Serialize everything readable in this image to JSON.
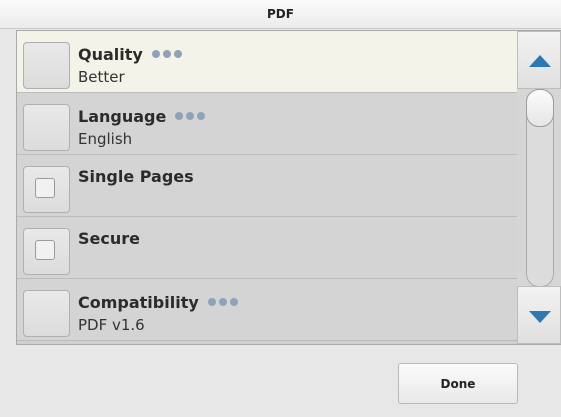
{
  "window": {
    "title": "PDF"
  },
  "settings": [
    {
      "title": "Quality",
      "value": "Better",
      "has_options": true,
      "selected": true
    },
    {
      "title": "Language",
      "value": "English",
      "has_options": true
    },
    {
      "title": "Single Pages",
      "value": "",
      "checkbox": true,
      "checked": false
    },
    {
      "title": "Secure",
      "value": "",
      "checkbox": true,
      "checked": false
    },
    {
      "title": "Compatibility",
      "value": "PDF v1.6",
      "has_options": true
    }
  ],
  "scrollbar": {
    "up_icon": "triangle-up",
    "down_icon": "triangle-down",
    "accent": "#2f77b5"
  },
  "footer": {
    "done_label": "Done"
  },
  "colors": {
    "selected_row": "#f4f3e9",
    "row": "#d4d4d4",
    "more_dots": "#8ea3b7"
  }
}
